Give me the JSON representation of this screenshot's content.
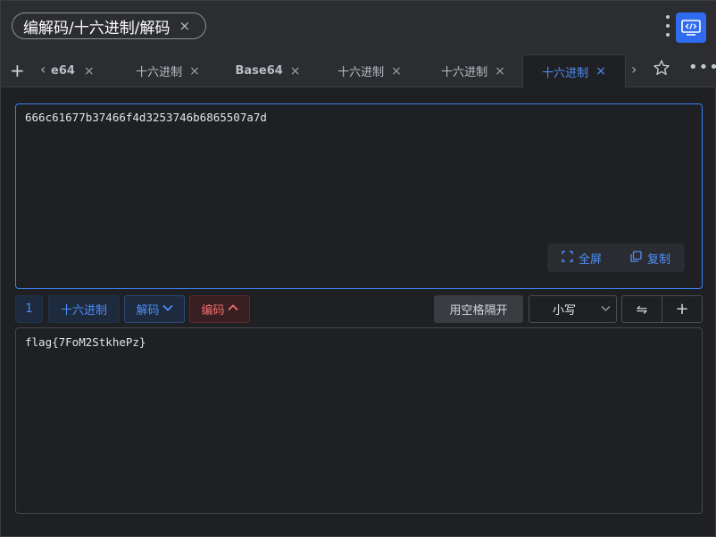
{
  "title": {
    "text": "编解码/十六进制/解码",
    "close": "×"
  },
  "tabs": {
    "add": "+",
    "prev": "‹",
    "next": "›",
    "close": "×",
    "more": "•••",
    "items": [
      {
        "label": "e64"
      },
      {
        "label": "十六进制"
      },
      {
        "label": "Base64"
      },
      {
        "label": "十六进制"
      },
      {
        "label": "十六进制"
      },
      {
        "label": "十六进制",
        "active": true
      }
    ]
  },
  "input": {
    "value": "666c61677b37466f4d3253746b6865507a7d",
    "fullscreen_label": "全屏",
    "copy_label": "复制"
  },
  "toolbar": {
    "count": "1",
    "format": "十六进制",
    "decode_label": "解码",
    "encode_label": "编码",
    "separator_label": "用空格隔开",
    "case_value": "小写",
    "swap_symbol": "⇋",
    "add_symbol": "+"
  },
  "output": {
    "value": "flag{7FoM2StkhePz}"
  },
  "colors": {
    "accent": "#4e8ff7",
    "danger": "#f16d6d",
    "app_icon_bg": "#2f6bf0"
  }
}
